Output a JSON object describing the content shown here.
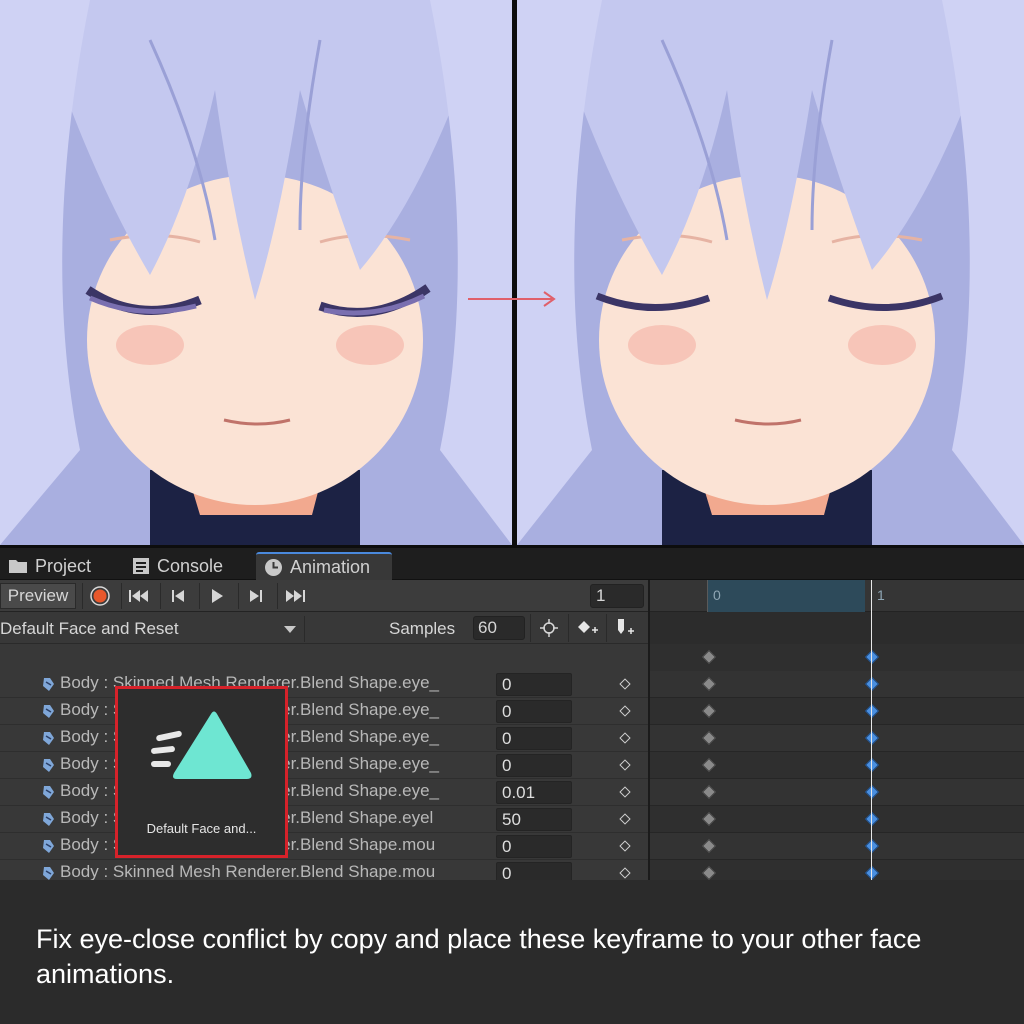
{
  "tabs": [
    {
      "label": "Project",
      "icon": "folder-icon"
    },
    {
      "label": "Console",
      "icon": "console-icon"
    },
    {
      "label": "Animation",
      "icon": "clock-icon",
      "active": true
    }
  ],
  "toolbar": {
    "preview_label": "Preview",
    "frame_value": "1"
  },
  "clipbar": {
    "clip_name": "Default Face and Reset",
    "samples_label": "Samples",
    "samples_value": "60"
  },
  "timeline": {
    "ruler_labels": [
      "0",
      "1"
    ]
  },
  "properties": [
    {
      "label": "Body : Skinned Mesh Renderer.Blend Shape.eye_",
      "value": "0"
    },
    {
      "label": "Body : Skinned Mesh Renderer.Blend Shape.eye_",
      "value": "0"
    },
    {
      "label": "Body : Skinned Mesh Renderer.Blend Shape.eye_",
      "value": "0"
    },
    {
      "label": "Body : Skinned Mesh Renderer.Blend Shape.eye_",
      "value": "0"
    },
    {
      "label": "Body : Skinned Mesh Renderer.Blend Shape.eye_",
      "value": "0.01"
    },
    {
      "label": "Body : Skinned Mesh Renderer.Blend Shape.eyel",
      "value": "50"
    },
    {
      "label": "Body : Skinned Mesh Renderer.Blend Shape.mou",
      "value": "0"
    },
    {
      "label": "Body : Skinned Mesh Renderer.Blend Shape.mou",
      "value": "0"
    }
  ],
  "thumbnail": {
    "label": "Default Face and...",
    "accent": "#6ee6d2",
    "border": "#d6222a"
  },
  "caption": "Fix eye-close conflict by copy and place these keyframe to your other face animations.",
  "colors": {
    "record": "#e8582c",
    "keyframe_selected": "#4a8fe0",
    "keyframe": "#8a8a8a",
    "arrow": "#e0606a"
  }
}
